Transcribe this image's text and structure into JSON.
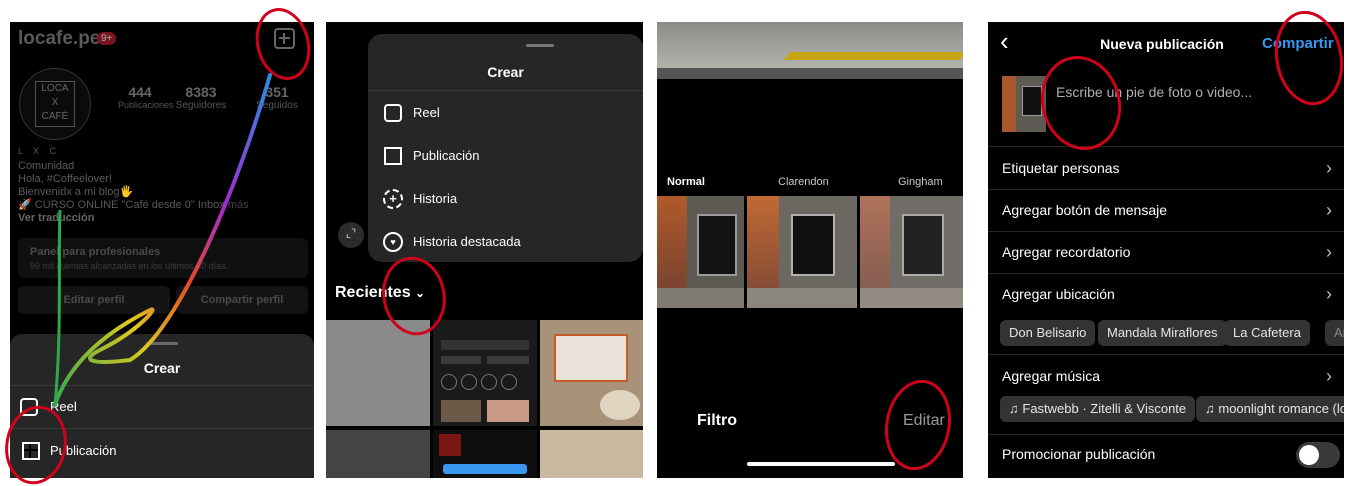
{
  "panel1": {
    "username": "locafe.pe",
    "badge": "9+",
    "avatar_text": [
      "LOCA",
      "X",
      "CAFÉ"
    ],
    "stats": [
      {
        "value": "444",
        "label": "Publicaciones"
      },
      {
        "value": "8383",
        "label": "Seguidores"
      },
      {
        "value": "351",
        "label": "Seguidos"
      }
    ],
    "bio_tags": "L X C",
    "bio_lines": [
      "Comunidad",
      "Hola, #Coffeelover!",
      "Bienvenidx a mi blog🖐"
    ],
    "bio_course": "🚀 CURSO ONLINE \"Café desde 0\" Inbox",
    "more_label": "más",
    "translate_label": "Ver traducción",
    "pro_panel_title": "Panel para profesionales",
    "pro_panel_sub": "99 mil cuentas alcanzadas en los últimos 30 días.",
    "edit_profile": "Editar perfil",
    "share_profile": "Compartir perfil",
    "sheet_title": "Crear",
    "sheet_items": [
      "Reel",
      "Publicación"
    ]
  },
  "panel2": {
    "menu_title": "Crear",
    "menu_items": [
      "Reel",
      "Publicación",
      "Historia",
      "Historia destacada"
    ],
    "recents_label": "Recientes"
  },
  "panel3": {
    "filters": [
      "Normal",
      "Clarendon",
      "Gingham"
    ],
    "filter_tab": "Filtro",
    "edit_tab": "Editar"
  },
  "panel4": {
    "title": "Nueva publicación",
    "share_label": "Compartir",
    "caption_placeholder": "Escribe un pie de foto o video...",
    "options": [
      "Etiquetar personas",
      "Agregar botón de mensaje",
      "Agregar recordatorio",
      "Agregar ubicación"
    ],
    "location_chips": [
      "Don Belisario",
      "Mandala Miraflores",
      "La Cafetera",
      "Artes"
    ],
    "music_label": "Agregar música",
    "music_chips": [
      "Fastwebb · Zitelli & Visconte",
      "moonlight romance (lo"
    ],
    "promote_label": "Promocionar publicación"
  },
  "colors": {
    "annotation_red": "#d0021b",
    "accent_blue": "#3897f0",
    "sheet_bg": "#262626"
  }
}
